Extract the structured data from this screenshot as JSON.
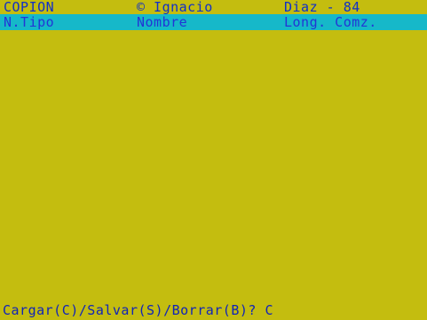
{
  "app": {
    "title": "COPION",
    "copyright": "© Ignacio",
    "author_year": "Diaz - 84"
  },
  "header": {
    "type_label": "N.Tipo",
    "name_label": "Nombre",
    "len_label": "Long. Comz."
  },
  "footer": {
    "prompt": "Cargar(C)/Salvar(S)/Borrar(B)? C"
  },
  "colors": {
    "background": "#c4bd0f",
    "header_bar": "#16b8c9",
    "text_blue": "#102fc8"
  }
}
